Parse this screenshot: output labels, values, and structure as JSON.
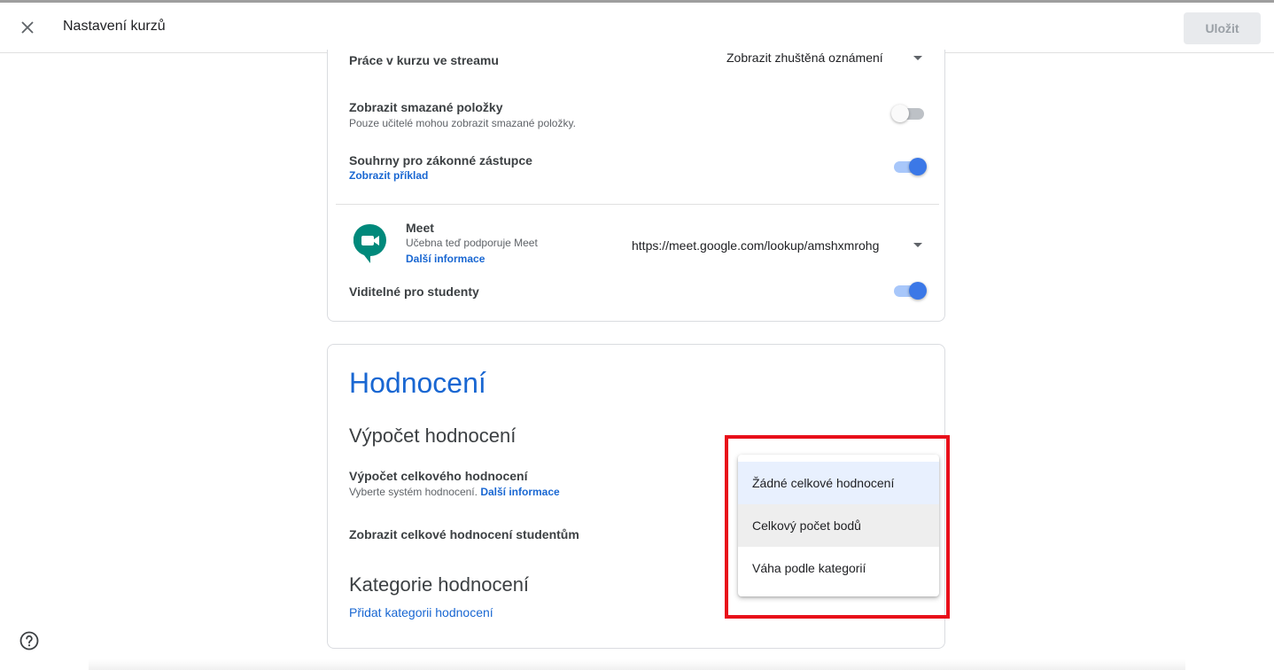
{
  "header": {
    "title": "Nastavení kurzů",
    "save_label": "Uložit"
  },
  "general": {
    "stream_label": "Práce v kurzu ve streamu",
    "stream_value": "Zobrazit zhuštěná oznámení",
    "deleted_label": "Zobrazit smazané položky",
    "deleted_sub": "Pouze učitelé mohou zobrazit smazané položky.",
    "deleted_on": false,
    "guardian_label": "Souhrny pro zákonné zástupce",
    "guardian_link": "Zobrazit příklad",
    "guardian_on": true,
    "meet_title": "Meet",
    "meet_sub": "Učebna teď podporuje Meet",
    "meet_link": "Další informace",
    "meet_url": "https://meet.google.com/lookup/amshxmrohg",
    "visible_label": "Viditelné pro studenty",
    "visible_on": true
  },
  "grading": {
    "title": "Hodnocení",
    "calc_heading": "Výpočet hodnocení",
    "overall_label": "Výpočet celkového hodnocení",
    "overall_sub": "Vyberte systém hodnocení.",
    "overall_link": "Další informace",
    "show_label": "Zobrazit celkové hodnocení studentům",
    "categories_heading": "Kategorie hodnocení",
    "add_category_link": "Přidat kategorii hodnocení"
  },
  "dropdown_menu": {
    "options": [
      "Žádné celkové hodnocení",
      "Celkový počet bodů",
      "Váha podle kategorií"
    ],
    "selected_index": 0,
    "hover_index": 1
  },
  "colors": {
    "accent": "#1967d2",
    "toggle_on": "#3b78e7",
    "highlight": "#e8101a",
    "meet_green": "#00897b"
  }
}
